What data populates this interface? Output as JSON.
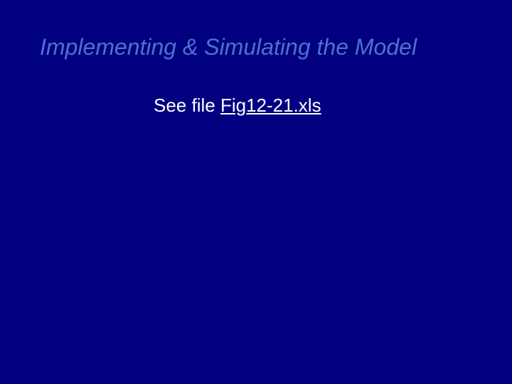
{
  "slide": {
    "title": "Implementing & Simulating the Model",
    "body_prefix": "See file ",
    "file_name": "Fig12-21.xls"
  }
}
